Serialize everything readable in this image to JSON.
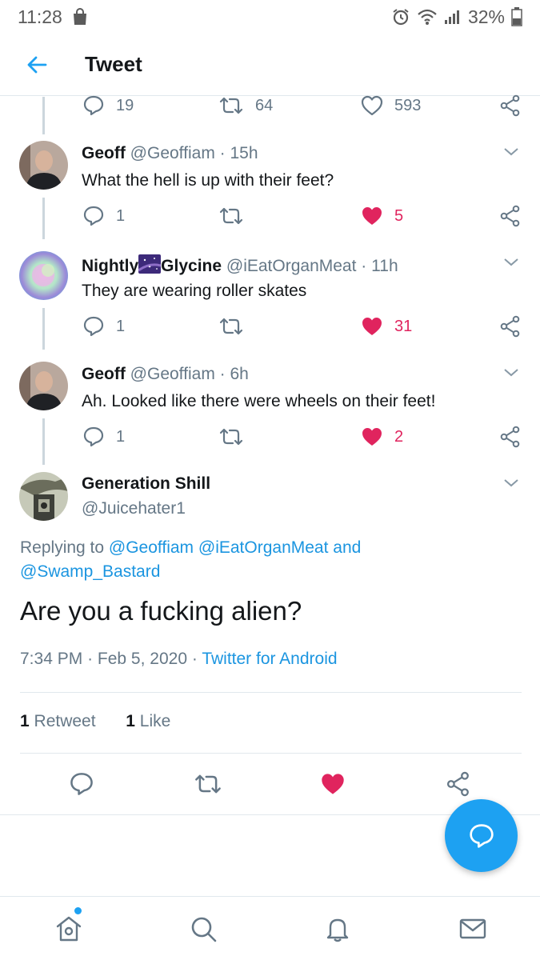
{
  "status_bar": {
    "time": "11:28",
    "battery": "32%"
  },
  "header": {
    "title": "Tweet"
  },
  "parent_actions": {
    "replies": "19",
    "retweets": "64",
    "likes": "593"
  },
  "replies": [
    {
      "name": "Geoff",
      "handle": "@Geoffiam",
      "time": "15h",
      "text": "What the hell is up with their feet?",
      "reply_count": "1",
      "like_count": "5",
      "liked": true
    },
    {
      "name_part1": "Nightly",
      "name_part2": "Glycine",
      "handle": "@iEatOrganMeat",
      "time": "11h",
      "text": "They are wearing roller skates",
      "reply_count": "1",
      "like_count": "31",
      "liked": true
    },
    {
      "name": "Geoff",
      "handle": "@Geoffiam",
      "time": "6h",
      "text": "Ah. Looked like there were wheels on their feet!",
      "reply_count": "1",
      "like_count": "2",
      "liked": true
    }
  ],
  "focal_tweet": {
    "name": "Generation Shill",
    "handle": "@Juicehater1",
    "replying_prefix": "Replying to ",
    "replying_to_1": "@Geoffiam",
    "replying_to_2": "@iEatOrganMeat",
    "replying_and": " and",
    "replying_to_3": "@Swamp_Bastard",
    "text": "Are you a fucking alien?",
    "time": "7:34 PM",
    "date": "Feb 5, 2020",
    "source": "Twitter for Android",
    "retweet_count": "1",
    "retweet_label": "Retweet",
    "like_count": "1",
    "like_label": "Like"
  },
  "colors": {
    "accent": "#1da1f2",
    "like": "#e0245e",
    "muted": "#657786"
  }
}
